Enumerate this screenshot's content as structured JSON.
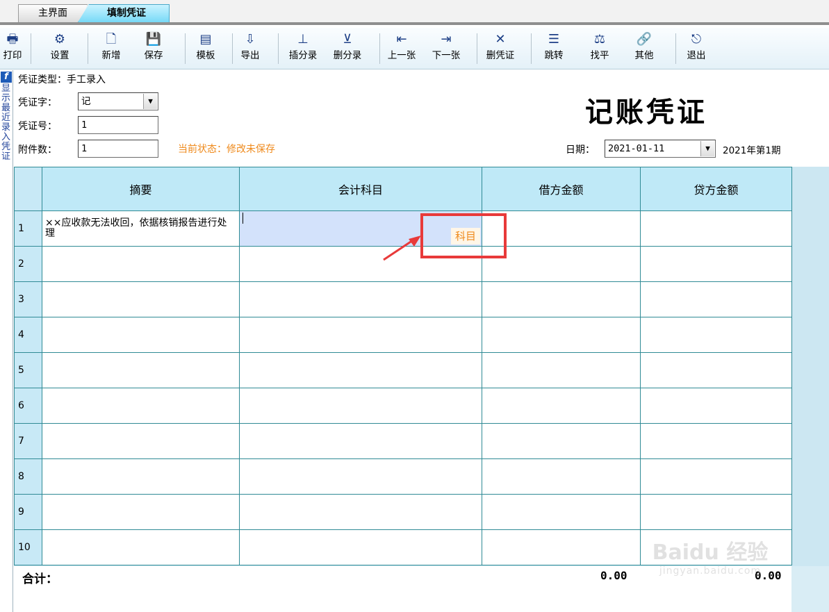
{
  "tabs": [
    {
      "label": "主界面"
    },
    {
      "label": "填制凭证"
    }
  ],
  "toolbar": [
    {
      "icon": "printer-icon",
      "glyph": "🖶",
      "label": "打印"
    },
    {
      "icon": "settings-icon",
      "glyph": "⚙",
      "label": "设置"
    },
    {
      "icon": "new-doc-icon",
      "glyph": "🗋",
      "label": "新增"
    },
    {
      "icon": "save-icon",
      "glyph": "💾",
      "label": "保存"
    },
    {
      "icon": "template-icon",
      "glyph": "▤",
      "label": "模板"
    },
    {
      "icon": "export-icon",
      "glyph": "⇩",
      "label": "导出"
    },
    {
      "icon": "insert-row-icon",
      "glyph": "⊥",
      "label": "插分录"
    },
    {
      "icon": "delete-row-icon",
      "glyph": "⊻",
      "label": "删分录"
    },
    {
      "icon": "prev-icon",
      "glyph": "⇤",
      "label": "上一张"
    },
    {
      "icon": "next-icon",
      "glyph": "⇥",
      "label": "下一张"
    },
    {
      "icon": "delete-voucher-icon",
      "glyph": "✕",
      "label": "删凭证"
    },
    {
      "icon": "jump-icon",
      "glyph": "☰",
      "label": "跳转"
    },
    {
      "icon": "balance-icon",
      "glyph": "⚖",
      "label": "找平"
    },
    {
      "icon": "other-icon",
      "glyph": "🔗",
      "label": "其他"
    },
    {
      "icon": "exit-icon",
      "glyph": "⎋",
      "label": "退出"
    }
  ],
  "left_strip": {
    "logo": "f",
    "text": "显示最近录入凭证"
  },
  "header": {
    "voucher_type": "凭证类型：手工录入",
    "word_label": "凭证字：",
    "word_value": "记",
    "number_label": "凭证号：",
    "number_value": "1",
    "attach_label": "附件数：",
    "attach_value": "1",
    "status": "当前状态：修改未保存",
    "title": "记账凭证",
    "date_label": "日期：",
    "date_value": "2021-01-11",
    "period": "2021年第1期"
  },
  "grid": {
    "columns": [
      "摘要",
      "会计科目",
      "借方金额",
      "贷方金额"
    ],
    "rows": [
      {
        "n": "1",
        "summary": "××应收款无法收回，依据核销报告进行处理",
        "account": "",
        "debit": "",
        "credit": ""
      },
      {
        "n": "2",
        "summary": "",
        "account": "",
        "debit": "",
        "credit": ""
      },
      {
        "n": "3",
        "summary": "",
        "account": "",
        "debit": "",
        "credit": ""
      },
      {
        "n": "4",
        "summary": "",
        "account": "",
        "debit": "",
        "credit": ""
      },
      {
        "n": "5",
        "summary": "",
        "account": "",
        "debit": "",
        "credit": ""
      },
      {
        "n": "6",
        "summary": "",
        "account": "",
        "debit": "",
        "credit": ""
      },
      {
        "n": "7",
        "summary": "",
        "account": "",
        "debit": "",
        "credit": ""
      },
      {
        "n": "8",
        "summary": "",
        "account": "",
        "debit": "",
        "credit": ""
      },
      {
        "n": "9",
        "summary": "",
        "account": "",
        "debit": "",
        "credit": ""
      },
      {
        "n": "10",
        "summary": "",
        "account": "",
        "debit": "",
        "credit": ""
      }
    ],
    "subject_tag": "科目"
  },
  "totals": {
    "label": "合计：",
    "debit": "0.00",
    "credit": "0.00"
  },
  "colors": {
    "status": "#ef8a1c",
    "highlight": "#e83a3a",
    "header_bg": "#bfe9f7",
    "grid_line": "#2f8a95"
  }
}
